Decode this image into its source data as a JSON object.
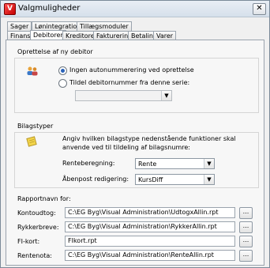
{
  "window": {
    "title": "Valgmuligheder",
    "close_label": "✕"
  },
  "tabs_row1": [
    {
      "label": "Sager"
    },
    {
      "label": "Lønintegration"
    },
    {
      "label": "Tillægsmoduler"
    }
  ],
  "tabs_row2": [
    {
      "label": "Finans"
    },
    {
      "label": "Debitorer"
    },
    {
      "label": "Kreditorer"
    },
    {
      "label": "Fakturering"
    },
    {
      "label": "Betaling"
    },
    {
      "label": "Varer"
    }
  ],
  "active_tab": "Debitorer",
  "oprettelse": {
    "title": "Oprettelse af ny debitor",
    "icon": "users-icon",
    "options": [
      {
        "label": "Ingen autonummerering ved oprettelse",
        "checked": true
      },
      {
        "label": "Tildel debitornummer fra denne serie:",
        "checked": false
      }
    ],
    "series_value": ""
  },
  "bilagstyper": {
    "title": "Bilagstyper",
    "icon": "notepad-icon",
    "description": "Angiv hvilken bilagstype nedenstående funktioner skal anvende ved til tildeling af bilagsnumre:",
    "rows": [
      {
        "label": "Renteberegning:",
        "value": "Rente"
      },
      {
        "label": "Åbenpost redigering:",
        "value": "KursDiff"
      }
    ]
  },
  "rapport": {
    "title": "Rapportnavn for:",
    "rows": [
      {
        "label": "Kontoudtog:",
        "value": "C:\\EG Byg\\Visual Administration\\UdtogxAllin.rpt"
      },
      {
        "label": "Rykkerbreve:",
        "value": "C:\\EG Byg\\Visual Administration\\RykkerAllin.rpt"
      },
      {
        "label": "FI-kort:",
        "value": "FIkort.rpt"
      },
      {
        "label": "Rentenota:",
        "value": "C:\\EG Byg\\Visual Administration\\RenteAllin.rpt"
      }
    ],
    "browse_label": "..."
  },
  "colors": {
    "accent": "#2a62b8",
    "border": "#9aa3ad"
  }
}
